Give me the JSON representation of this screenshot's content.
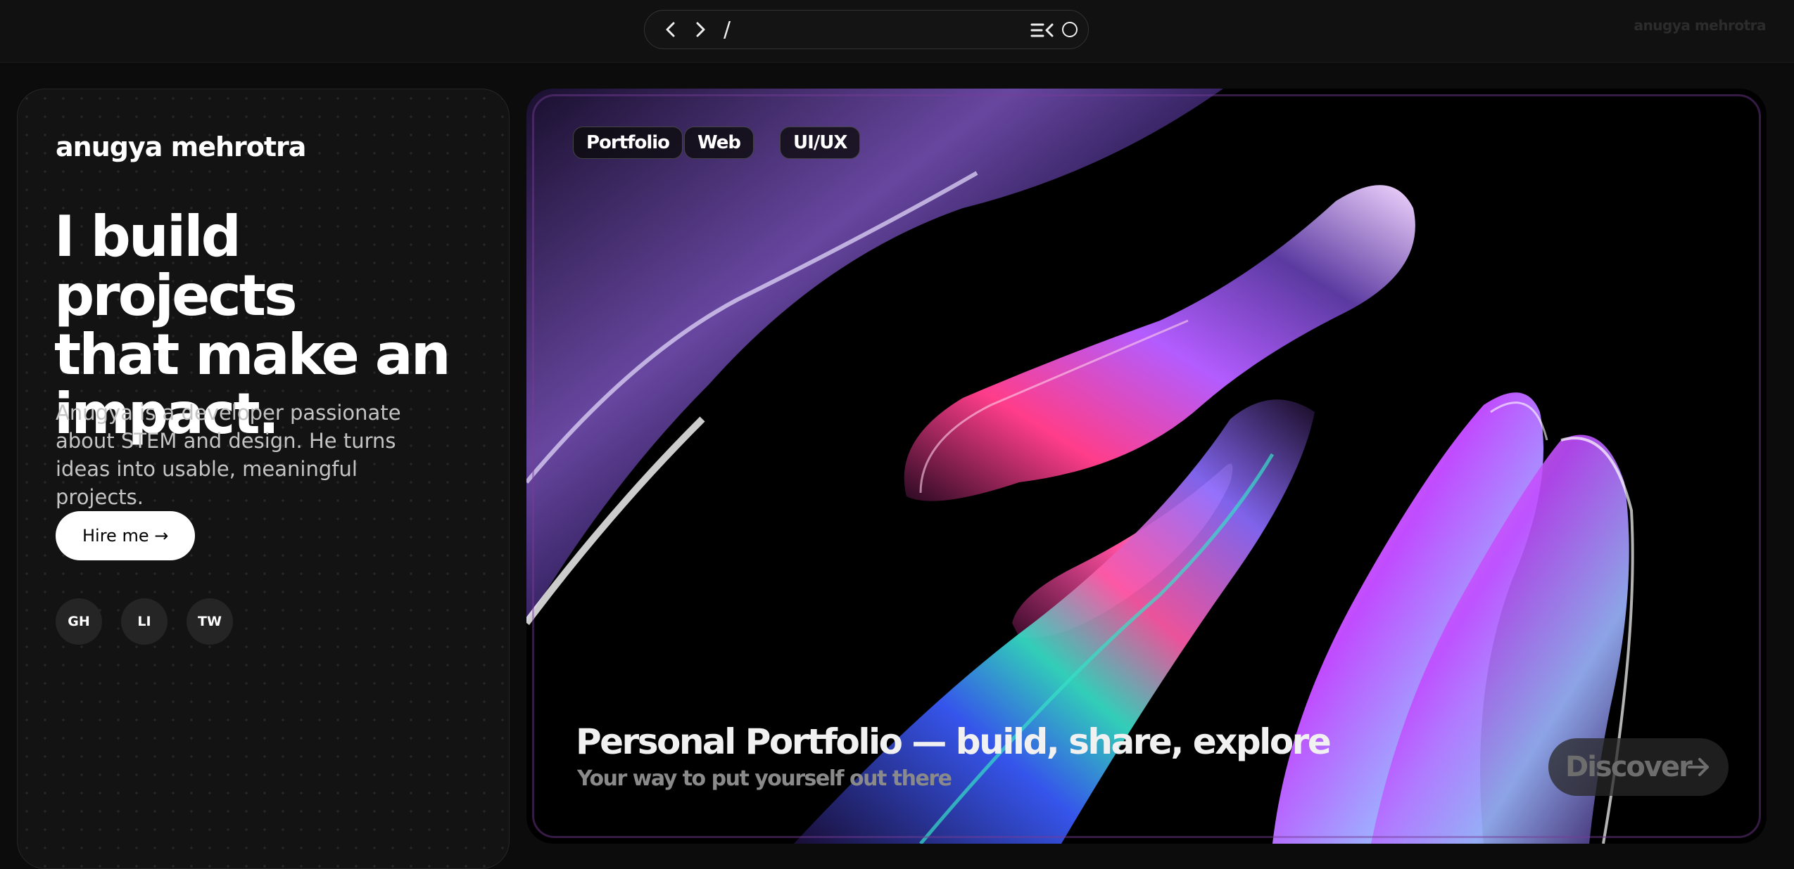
{
  "topbar": {
    "path": "/",
    "watermark": "anugya mehrotra"
  },
  "sidebar": {
    "brand": "anugya mehrotra",
    "headline": [
      "I build projects",
      "that make an",
      "impact."
    ],
    "description": "Anugya is a developer passionate about STEM and design. He turns ideas into usable, meaningful projects.",
    "hire_label": "Hire me →",
    "socials": [
      "GH",
      "LI",
      "TW"
    ]
  },
  "hero": {
    "tags": [
      "Portfolio",
      "Web",
      "UI/UX"
    ],
    "title": "Personal Portfolio — build, share, explore",
    "subtitle": "Your way to put yourself out there",
    "discover_label": "Discover"
  },
  "colors": {
    "background": "#0c0c0c",
    "card": "#131313",
    "accent_pink": "#ff3d8a",
    "accent_violet": "#7a5cff",
    "accent_teal": "#36e0c8"
  }
}
